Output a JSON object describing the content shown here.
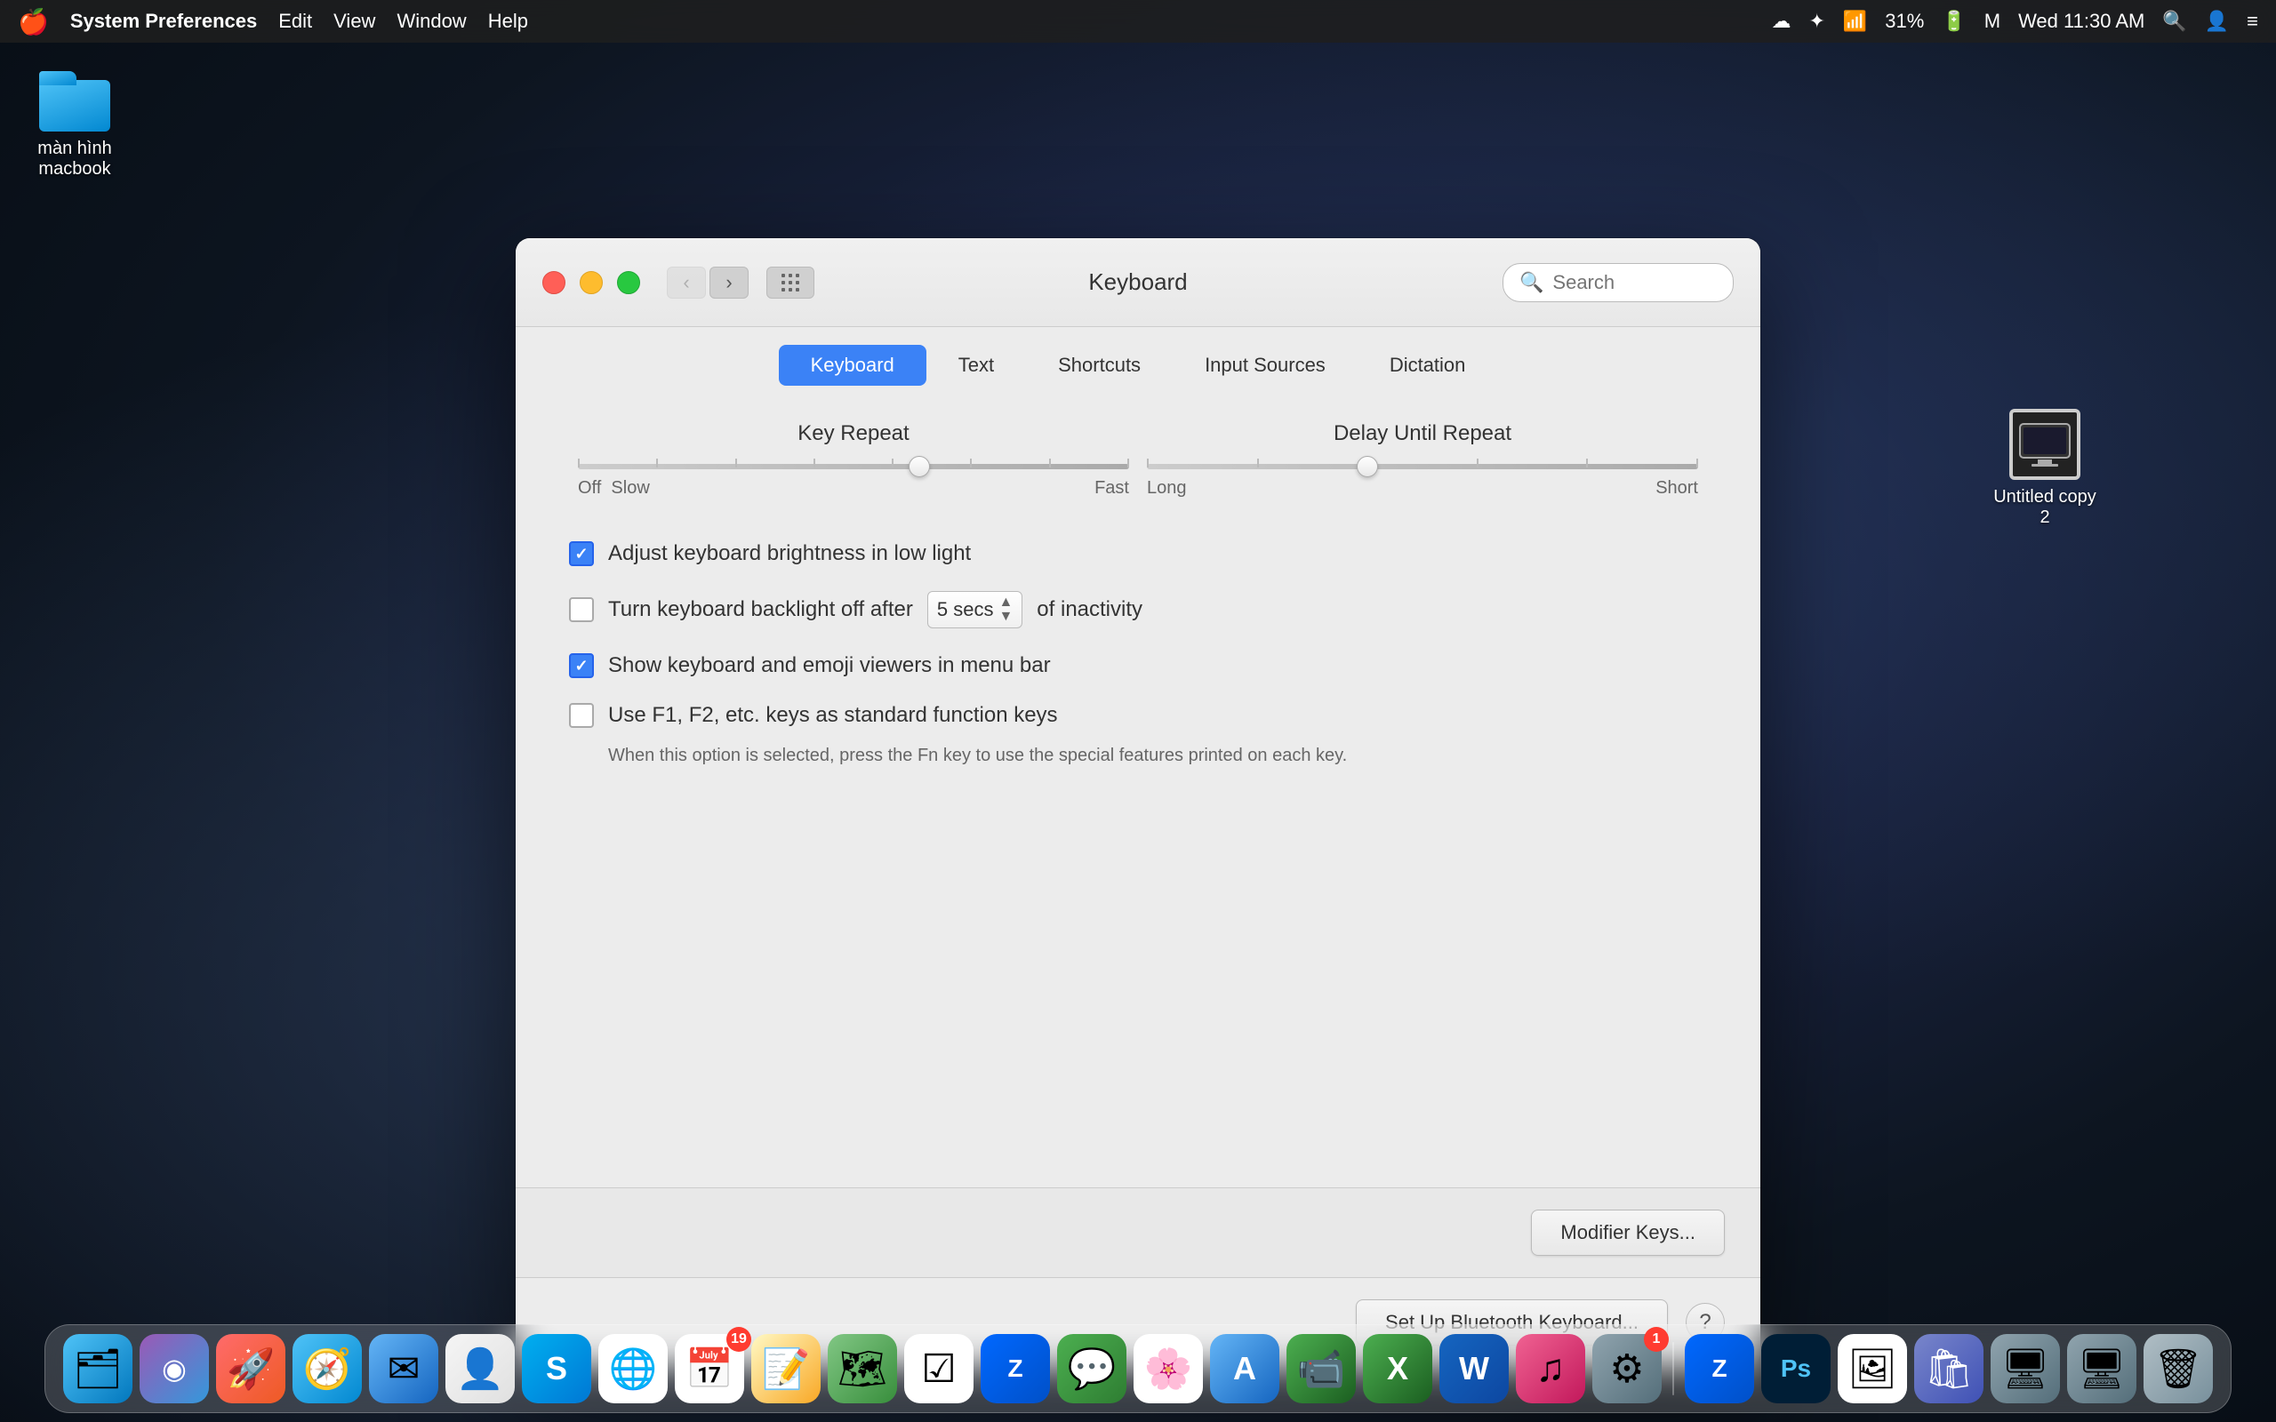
{
  "desktop": {
    "bg_label": "macOS Mojave Desktop"
  },
  "menubar": {
    "apple": "🍎",
    "items": [
      "System Preferences",
      "Edit",
      "View",
      "Window",
      "Help"
    ],
    "time": "Wed 11:30 AM",
    "battery": "31%"
  },
  "desktop_icons": [
    {
      "id": "folder-icon",
      "label": "màn hình macbook"
    },
    {
      "id": "monitor-icon",
      "label": "Untitled copy 2"
    }
  ],
  "window": {
    "title": "Keyboard",
    "search_placeholder": "Search",
    "tabs": [
      {
        "id": "tab-keyboard",
        "label": "Keyboard",
        "active": true
      },
      {
        "id": "tab-text",
        "label": "Text",
        "active": false
      },
      {
        "id": "tab-shortcuts",
        "label": "Shortcuts",
        "active": false
      },
      {
        "id": "tab-input-sources",
        "label": "Input Sources",
        "active": false
      },
      {
        "id": "tab-dictation",
        "label": "Dictation",
        "active": false
      }
    ],
    "key_repeat": {
      "label": "Key Repeat",
      "left_label": "Off",
      "left_label2": "Slow",
      "right_label": "Fast",
      "thumb_position_pct": 62
    },
    "delay_until_repeat": {
      "label": "Delay Until Repeat",
      "left_label": "Long",
      "right_label": "Short",
      "thumb_position_pct": 40
    },
    "checkboxes": [
      {
        "id": "cb-brightness",
        "checked": true,
        "label": "Adjust keyboard brightness in low light",
        "sublabel": ""
      },
      {
        "id": "cb-backlight",
        "checked": false,
        "label_prefix": "Turn keyboard backlight off after",
        "select_value": "5 secs",
        "label_suffix": "of inactivity",
        "has_select": true
      },
      {
        "id": "cb-emoji",
        "checked": true,
        "label": "Show keyboard and emoji viewers in menu bar",
        "sublabel": ""
      },
      {
        "id": "cb-fn",
        "checked": false,
        "label": "Use F1, F2, etc. keys as standard function keys",
        "sublabel": "When this option is selected, press the Fn key to use the special features printed on each key."
      }
    ],
    "buttons": {
      "modifier_keys": "Modifier Keys...",
      "bluetooth_keyboard": "Set Up Bluetooth Keyboard...",
      "help": "?"
    }
  },
  "dock": {
    "apps": [
      {
        "id": "finder",
        "icon": "🗂",
        "class": "dock-finder",
        "label": "Finder"
      },
      {
        "id": "siri",
        "icon": "◉",
        "class": "dock-siri",
        "label": "Siri"
      },
      {
        "id": "launchpad",
        "icon": "🚀",
        "class": "dock-launchpad",
        "label": "Launchpad"
      },
      {
        "id": "safari",
        "icon": "🧭",
        "class": "dock-safari",
        "label": "Safari"
      },
      {
        "id": "mail",
        "icon": "✉",
        "class": "dock-mail",
        "label": "Mail"
      },
      {
        "id": "contacts",
        "icon": "👤",
        "class": "dock-contacts",
        "label": "Contacts"
      },
      {
        "id": "skype",
        "icon": "S",
        "class": "dock-skype",
        "label": "Skype"
      },
      {
        "id": "chrome",
        "icon": "⊕",
        "class": "dock-chrome",
        "label": "Chrome"
      },
      {
        "id": "calendar",
        "icon": "📅",
        "class": "dock-calendar",
        "label": "Calendar",
        "badge": "19"
      },
      {
        "id": "notes",
        "icon": "📝",
        "class": "dock-notes",
        "label": "Notes"
      },
      {
        "id": "maps",
        "icon": "🗺",
        "class": "dock-maps",
        "label": "Maps"
      },
      {
        "id": "reminder",
        "icon": "☑",
        "class": "dock-reminder",
        "label": "Reminders"
      },
      {
        "id": "zalo",
        "icon": "Z",
        "class": "dock-zalo",
        "label": "Zalo"
      },
      {
        "id": "messages",
        "icon": "💬",
        "class": "dock-messages",
        "label": "Messages"
      },
      {
        "id": "photos",
        "icon": "🌸",
        "class": "dock-photos",
        "label": "Photos"
      },
      {
        "id": "appstore",
        "icon": "A",
        "class": "dock-appstore",
        "label": "App Store"
      },
      {
        "id": "facetime",
        "icon": "📹",
        "class": "dock-facetime",
        "label": "FaceTime"
      },
      {
        "id": "excel",
        "icon": "X",
        "class": "dock-excel",
        "label": "Excel"
      },
      {
        "id": "word",
        "icon": "W",
        "class": "dock-word",
        "label": "Word"
      },
      {
        "id": "music",
        "icon": "♫",
        "class": "dock-music",
        "label": "Music"
      },
      {
        "id": "settings",
        "icon": "⚙",
        "class": "dock-settings",
        "label": "System Preferences",
        "badge": "1"
      },
      {
        "id": "zalo2",
        "icon": "Z",
        "class": "dock-zalo2",
        "label": "Zalo"
      },
      {
        "id": "photoshop",
        "icon": "Ps",
        "class": "dock-photoshop",
        "label": "Photoshop"
      },
      {
        "id": "preview",
        "icon": "🖼",
        "class": "dock-preview",
        "label": "Preview"
      },
      {
        "id": "store2",
        "icon": "🛍",
        "class": "dock-store",
        "label": "Store"
      },
      {
        "id": "monitor2",
        "icon": "🖥",
        "class": "dock-monitor",
        "label": "Monitor"
      },
      {
        "id": "trash",
        "icon": "🗑",
        "class": "dock-trash",
        "label": "Trash"
      }
    ]
  }
}
